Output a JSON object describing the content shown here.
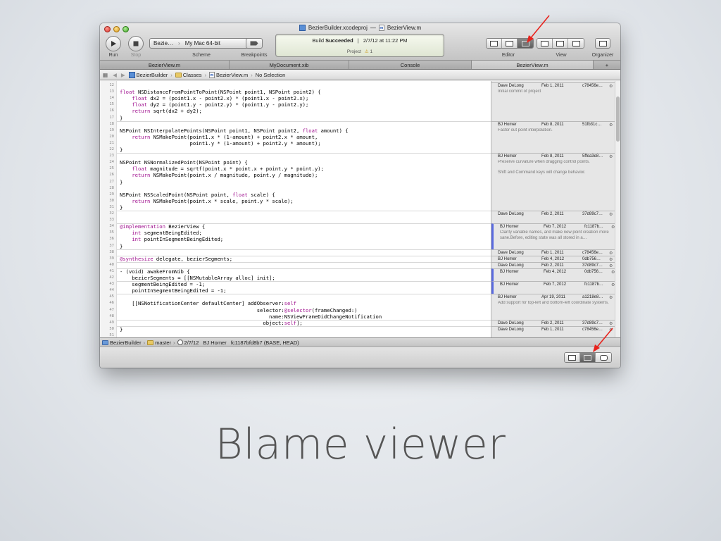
{
  "window_title": {
    "project": "BezierBuilder.xcodeproj",
    "separator": "—",
    "file": "BezierView.m",
    "file_icon": "m"
  },
  "toolbar": {
    "run_label": "Run",
    "stop_label": "Stop",
    "scheme": {
      "target": "Bezie…",
      "destination": "My Mac 64-bit",
      "label": "Scheme"
    },
    "breakpoints_label": "Breakpoints",
    "activity": {
      "build": "Build",
      "status": "Succeeded",
      "separator": "|",
      "timestamp": "2/7/12 at 11:22 PM",
      "project_label": "Project",
      "warnings": "1"
    },
    "editor_label": "Editor",
    "view_label": "View",
    "organizer_label": "Organizer"
  },
  "tabs": [
    {
      "label": "BezierView.m",
      "active": false
    },
    {
      "label": "MyDocument.xib",
      "active": false
    },
    {
      "label": "Console",
      "active": false
    },
    {
      "label": "BezierView.m",
      "active": true
    }
  ],
  "tab_add": "+",
  "jumpbar": {
    "items": [
      "BezierBuilder",
      "Classes",
      "BezierView.m",
      "No Selection"
    ],
    "file_icon": "m"
  },
  "code_lines": [
    {
      "n": "12",
      "t": ""
    },
    {
      "n": "13",
      "t": "float NSDistanceFromPointToPoint(NSPoint point1, NSPoint point2) {"
    },
    {
      "n": "14",
      "t": "    float dx2 = (point1.x - point2.x) * (point1.x - point2.x);"
    },
    {
      "n": "15",
      "t": "    float dy2 = (point1.y - point2.y) * (point1.y - point2.y);"
    },
    {
      "n": "16",
      "t": "    return sqrt(dx2 + dy2);"
    },
    {
      "n": "17",
      "t": "}"
    },
    {
      "n": "18",
      "t": ""
    },
    {
      "n": "19",
      "t": "NSPoint NSInterpolatePoints(NSPoint point1, NSPoint point2, float amount) {"
    },
    {
      "n": "20",
      "t": "    return NSMakePoint(point1.x * (1-amount) + point2.x * amount,"
    },
    {
      "n": "21",
      "t": "                       point1.y * (1-amount) + point2.y * amount);"
    },
    {
      "n": "22",
      "t": "}"
    },
    {
      "n": "23",
      "t": ""
    },
    {
      "n": "24",
      "t": "NSPoint NSNormalizedPoint(NSPoint point) {"
    },
    {
      "n": "25",
      "t": "    float magnitude = sqrtf(point.x * point.x + point.y * point.y);"
    },
    {
      "n": "26",
      "t": "    return NSMakePoint(point.x / magnitude, point.y / magnitude);"
    },
    {
      "n": "27",
      "t": "}"
    },
    {
      "n": "28",
      "t": ""
    },
    {
      "n": "29",
      "t": "NSPoint NSScaledPoint(NSPoint point, float scale) {"
    },
    {
      "n": "30",
      "t": "    return NSMakePoint(point.x * scale, point.y * scale);"
    },
    {
      "n": "31",
      "t": "}"
    },
    {
      "n": "32",
      "t": ""
    },
    {
      "n": "33",
      "t": ""
    },
    {
      "n": "34",
      "t": "@implementation BezierView {"
    },
    {
      "n": "35",
      "t": "    int segmentBeingEdited;"
    },
    {
      "n": "36",
      "t": "    int pointInSegmentBeingEdited;"
    },
    {
      "n": "37",
      "t": "}"
    },
    {
      "n": "38",
      "t": ""
    },
    {
      "n": "39",
      "t": "@synthesize delegate, bezierSegments;"
    },
    {
      "n": "40",
      "t": ""
    },
    {
      "n": "41",
      "t": "- (void) awakeFromNib {"
    },
    {
      "n": "42",
      "t": "    bezierSegments = [[NSMutableArray alloc] init];"
    },
    {
      "n": "43",
      "t": "    segmentBeingEdited = -1;"
    },
    {
      "n": "44",
      "t": "    pointInSegmentBeingEdited = -1;"
    },
    {
      "n": "45",
      "t": ""
    },
    {
      "n": "46",
      "t": "    [[NSNotificationCenter defaultCenter] addObserver:self"
    },
    {
      "n": "47",
      "t": "                                             selector:@selector(frameChanged:)"
    },
    {
      "n": "48",
      "t": "                                                 name:NSViewFrameDidChangeNotification"
    },
    {
      "n": "49",
      "t": "                                               object:self];"
    },
    {
      "n": "50",
      "t": "}"
    },
    {
      "n": "51",
      "t": ""
    }
  ],
  "blame": [
    {
      "author": "Dave DeLong",
      "date": "Feb 1, 2011",
      "hash": "c78456e…",
      "message": "Initial commit of project",
      "highlight": false
    },
    {
      "author": "BJ Homer",
      "date": "Feb 8, 2011",
      "hash": "51fb31c…",
      "message": "Factor out point interpolation.",
      "highlight": false
    },
    {
      "author": "BJ Homer",
      "date": "Feb 8, 2011",
      "hash": "5ffea3e8…",
      "message": "Preserve curvature when dragging control points.\n\nShift and Command keys will change behavior.",
      "highlight": false
    },
    {
      "author": "Dave DeLong",
      "date": "Feb 2, 2011",
      "hash": "37d89c7…",
      "message": "",
      "highlight": false
    },
    {
      "author": "BJ Homer",
      "date": "Feb 7, 2012",
      "hash": "fc1187b…",
      "message": "Clarify variable names, and make new point creation more sane.Before, editing state was all stored in a…",
      "highlight": true
    },
    {
      "author": "Dave DeLong",
      "date": "Feb 1, 2011",
      "hash": "c78456e…",
      "message": "",
      "highlight": false
    },
    {
      "author": "BJ Homer",
      "date": "Feb 4, 2012",
      "hash": "0db756…",
      "message": "",
      "highlight": false
    },
    {
      "author": "Dave DeLong",
      "date": "Feb 2, 2011",
      "hash": "37d89c7…",
      "message": "",
      "highlight": false
    },
    {
      "author": "BJ Homer",
      "date": "Feb 4, 2012",
      "hash": "0db756…",
      "message": "",
      "highlight": true
    },
    {
      "author": "BJ Homer",
      "date": "Feb 7, 2012",
      "hash": "fc1187b…",
      "message": "",
      "highlight": true
    },
    {
      "author": "BJ Homer",
      "date": "Apr 19, 2011",
      "hash": "a1218e8…",
      "message": "Add support for top-left and bottom-left coordinate systems.",
      "highlight": false
    },
    {
      "author": "Dave DeLong",
      "date": "Feb 2, 2011",
      "hash": "37d89c7…",
      "message": "",
      "highlight": false
    },
    {
      "author": "Dave DeLong",
      "date": "Feb 1, 2011",
      "hash": "c78456e…",
      "message": "",
      "highlight": false
    }
  ],
  "statusbar": {
    "project": "BezierBuilder",
    "branch": "master",
    "date": "2/7/12",
    "author": "BJ Homer",
    "commit": "fc1187bfd8b7 (BASE, HEAD)"
  },
  "caption": "Blame viewer",
  "colors": {
    "arrow": "#e8231d",
    "blame_highlight": "#5a6ae0",
    "keyword": "#a0128f"
  }
}
